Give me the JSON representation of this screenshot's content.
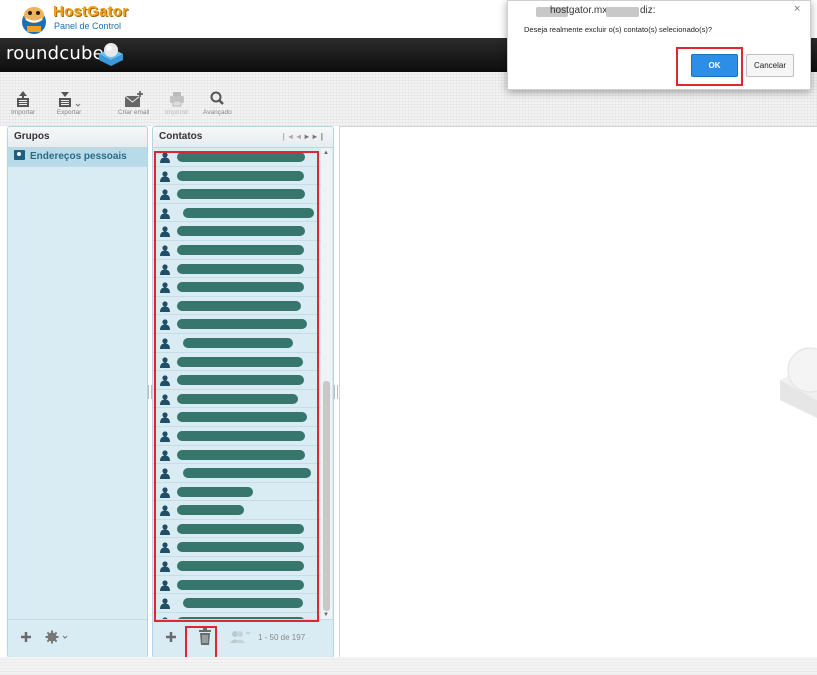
{
  "header": {
    "brand_title": "HostGator",
    "brand_subtitle": "Panel de Control",
    "app_name": "roundcube"
  },
  "toolbar": {
    "import_label": "Importar",
    "export_label": "Exportar",
    "compose_label": "Criar email",
    "print_label": "Imprimir",
    "search_label": "Avançado"
  },
  "groups": {
    "title": "Grupos",
    "items": [
      {
        "label": "Endereços pessoais",
        "selected": true
      }
    ]
  },
  "contacts": {
    "title": "Contatos",
    "count_label": "1 - 50 de 197",
    "bar_lengths": [
      0.88,
      0.87,
      0.88,
      0.9,
      0.88,
      0.87,
      0.87,
      0.87,
      0.85,
      0.89,
      0.75,
      0.86,
      0.87,
      0.83,
      0.89,
      0.88,
      0.88,
      0.88,
      0.52,
      0.46,
      0.87,
      0.87,
      0.87,
      0.87,
      0.82,
      0.88
    ],
    "names_redacted": true
  },
  "dialog": {
    "origin": "hostgator.mx",
    "origin_suffix": "diz:",
    "message": "Deseja realmente excluir o(s) contato(s) selecionado(s)?",
    "ok_label": "OK",
    "cancel_label": "Cancelar",
    "close_glyph": "×"
  },
  "colors": {
    "accent_highlight": "#e0262f",
    "ok_button": "#2d8ee8",
    "panel_bg": "#d9ecf4",
    "redaction": "#36766c"
  },
  "icons": {
    "import": "import-icon",
    "export": "export-icon",
    "compose": "compose-mail-icon",
    "print": "print-icon",
    "search": "search-icon",
    "contact": "person-icon",
    "add": "plus-icon",
    "settings": "gear-icon",
    "delete": "trash-icon",
    "group_add": "group-add-icon"
  }
}
